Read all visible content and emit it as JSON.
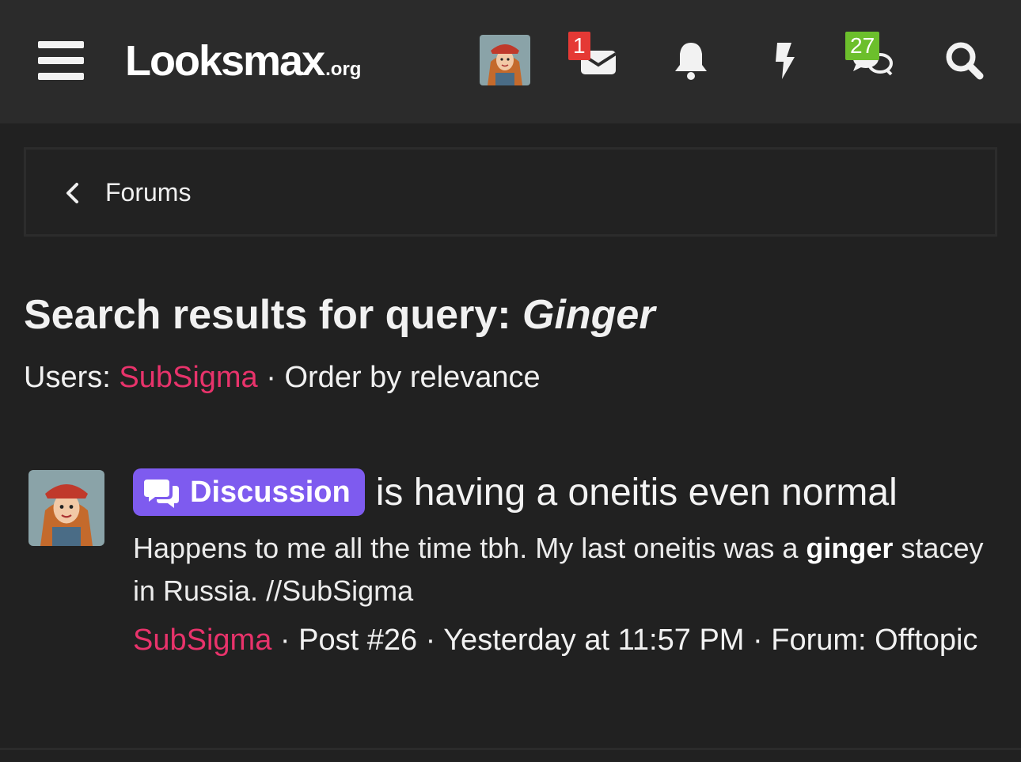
{
  "header": {
    "logo_main": "Looksmax",
    "logo_tld": ".org",
    "inbox_badge": "1",
    "alerts_badge": "27"
  },
  "breadcrumb": {
    "label": "Forums"
  },
  "search": {
    "title_prefix": "Search results for query: ",
    "query": "Ginger",
    "users_label": "Users: ",
    "user": "SubSigma",
    "separator": " · ",
    "order": "Order by relevance"
  },
  "result": {
    "prefix": "Discussion",
    "title": "is having a oneitis even normal",
    "snippet_before": "Happens to me all the time tbh. My last oneitis was a ",
    "snippet_highlight": "ginger",
    "snippet_after": " stacey in Russia. //SubSigma",
    "author": "SubSigma",
    "post": "Post #26",
    "time": "Yesterday at 11:57 PM",
    "forum_label": "Forum:",
    "forum": "Offtopic"
  },
  "colors": {
    "accent": "#e8336b",
    "prefix_bg": "#7e5bef",
    "badge_red": "#e53935",
    "badge_green": "#6cbf2c"
  }
}
